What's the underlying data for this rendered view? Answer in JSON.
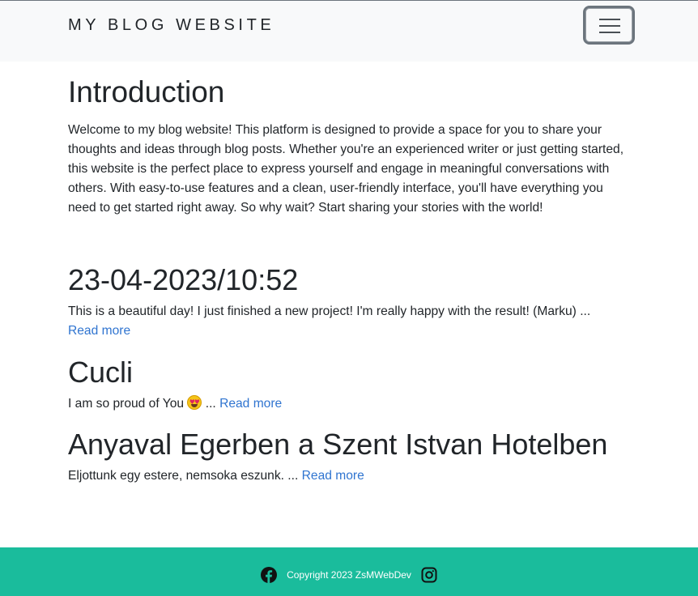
{
  "navbar": {
    "brand": "MY BLOG WEBSITE",
    "toggler_icon": "hamburger-menu-icon"
  },
  "intro": {
    "title": "Introduction",
    "text": "Welcome to my blog website! This platform is designed to provide a space for you to share your thoughts and ideas through blog posts. Whether you're an experienced writer or just getting started, this website is the perfect place to express yourself and engage in meaningful conversations with others. With easy-to-use features and a clean, user-friendly interface, you'll have everything you need to get started right away. So why wait? Start sharing your stories with the world!"
  },
  "posts": [
    {
      "title": "23-04-2023/10:52",
      "excerpt": "This is a beautiful day! I just finished a new project! I'm really happy with the result! (Marku) ...",
      "read_more": "Read more"
    },
    {
      "title": "Cucli",
      "excerpt_before": "I am so proud of You",
      "emoji": "star-struck-emoji",
      "excerpt_after": "...",
      "read_more": "Read more"
    },
    {
      "title": "Anyaval Egerben a Szent Istvan Hotelben",
      "excerpt": "Eljottunk egy estere, nemsoka eszunk. ...",
      "read_more": "Read more"
    }
  ],
  "footer": {
    "copyright": "Copyright 2023 ZsMWebDev",
    "left_icon": "facebook-icon",
    "right_icon": "instagram-icon",
    "background": "#1abc9c"
  },
  "colors": {
    "link": "#2f74d0",
    "text": "#212529",
    "navbar_bg": "#f8f9fa"
  }
}
